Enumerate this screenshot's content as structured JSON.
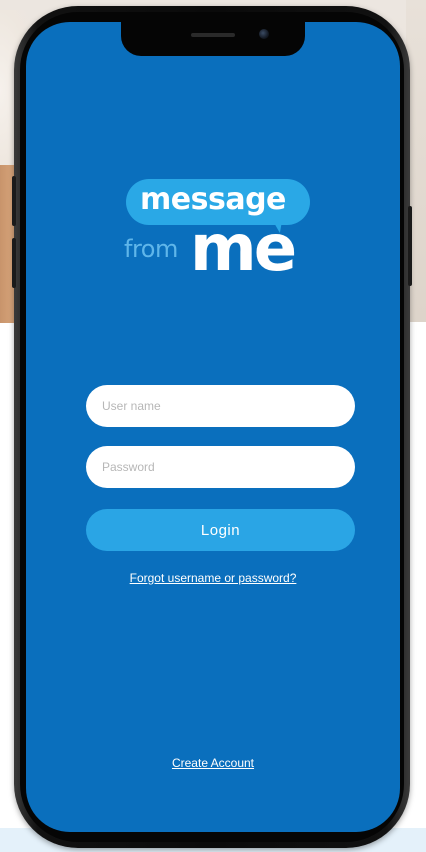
{
  "app": {
    "name": "message from me"
  },
  "logo": {
    "line1": "message",
    "line2_small": "from",
    "line2_big": "me"
  },
  "login_form": {
    "username_placeholder": "User name",
    "username_value": "",
    "password_placeholder": "Password",
    "password_value": "",
    "login_label": "Login",
    "forgot_link": "Forgot username or password?",
    "create_account_link": "Create Account"
  },
  "colors": {
    "screen_background": "#0a6fbd",
    "logo_bubble": "#2aa8e6",
    "login_button": "#2aa5e5",
    "field_background": "#ffffff",
    "text_light": "#ffffff"
  },
  "icons": {
    "camera": "front-camera-icon",
    "speaker": "earpiece-speaker-icon"
  }
}
